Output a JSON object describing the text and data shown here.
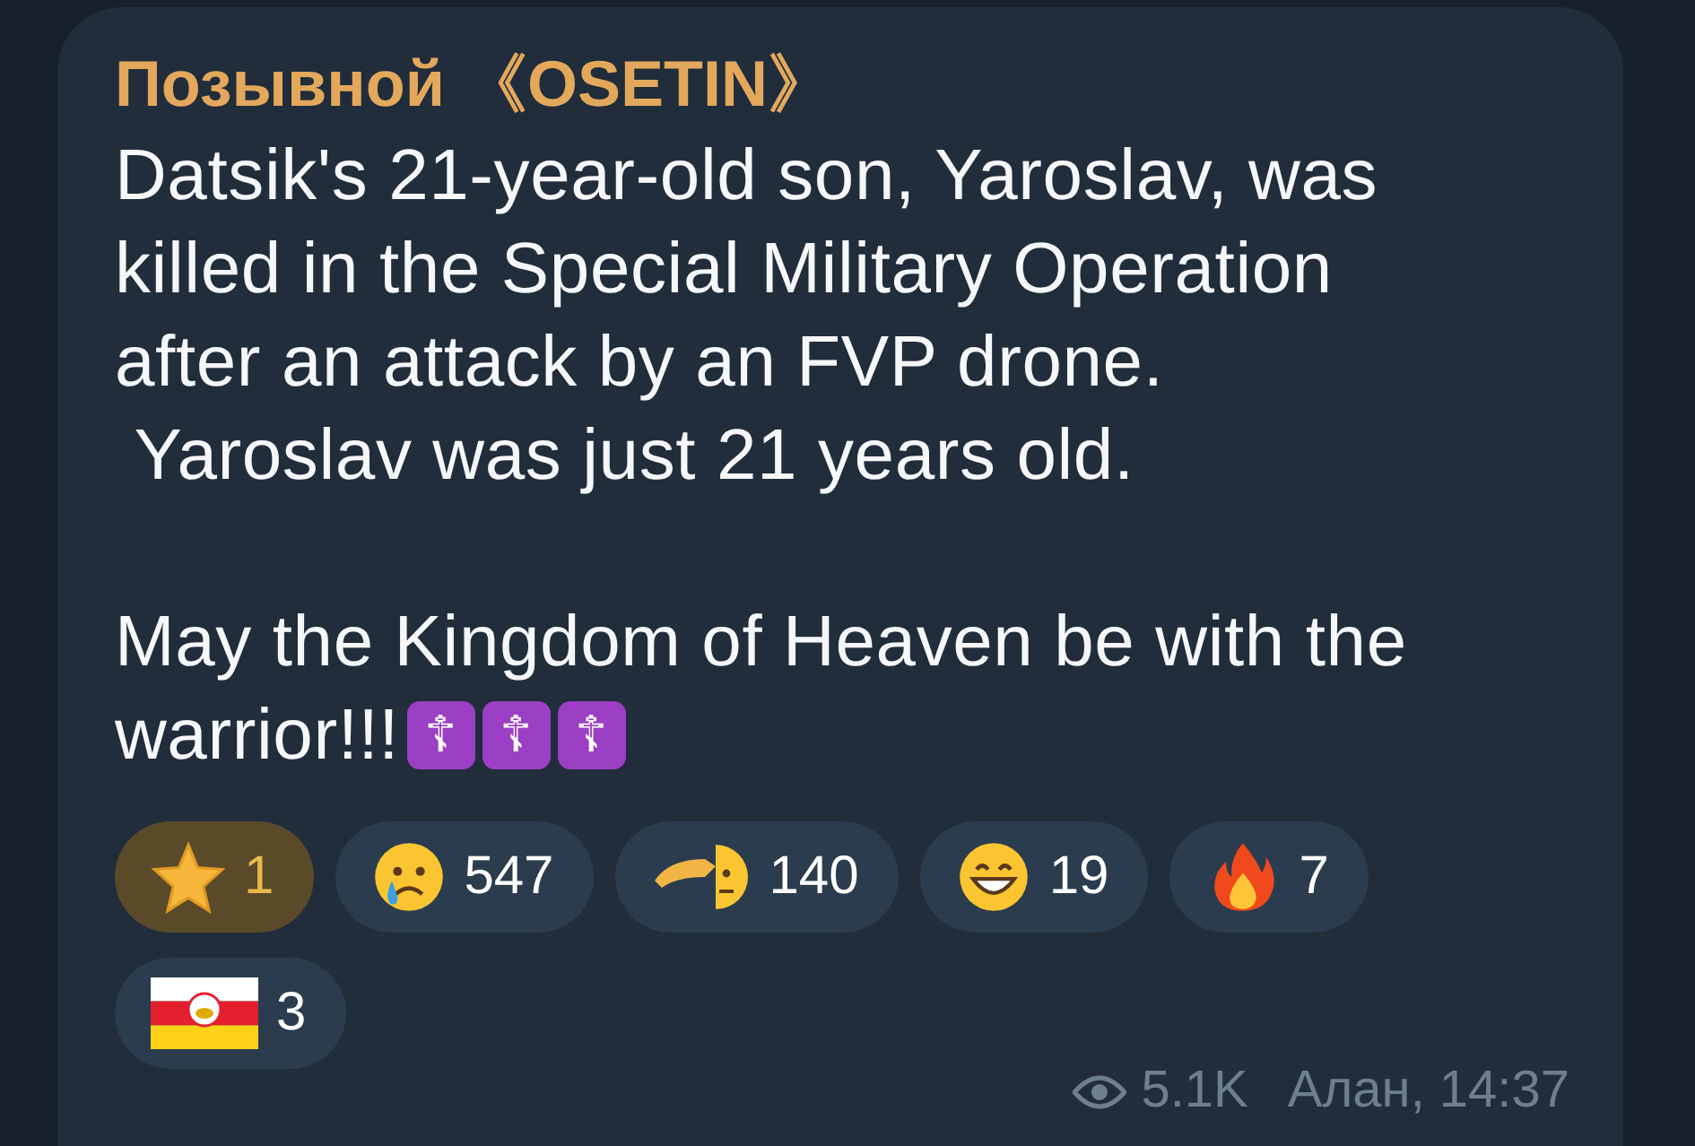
{
  "message": {
    "author": "Позывной 《OSETIN》",
    "text": "Datsik's 21-year-old son, Yaroslav, was\nkilled in the Special Military Operation\nafter an attack by an FVP drone.\n Yaroslav was just 21 years old.",
    "closing_lines": [
      "May the Kingdom of Heaven be with the",
      "warrior!!!"
    ],
    "emoji": [
      "☦",
      "☦",
      "☦"
    ],
    "reactions": [
      {
        "kind": "star",
        "count": "1",
        "selected": true
      },
      {
        "kind": "crying",
        "count": "547",
        "selected": false
      },
      {
        "kind": "salute",
        "count": "140",
        "selected": false
      },
      {
        "kind": "grin",
        "count": "19",
        "selected": false
      },
      {
        "kind": "fire",
        "count": "7",
        "selected": false
      },
      {
        "kind": "flag",
        "count": "3",
        "selected": false
      }
    ],
    "views": "5.1K",
    "signature": "Алан, 14:37"
  }
}
